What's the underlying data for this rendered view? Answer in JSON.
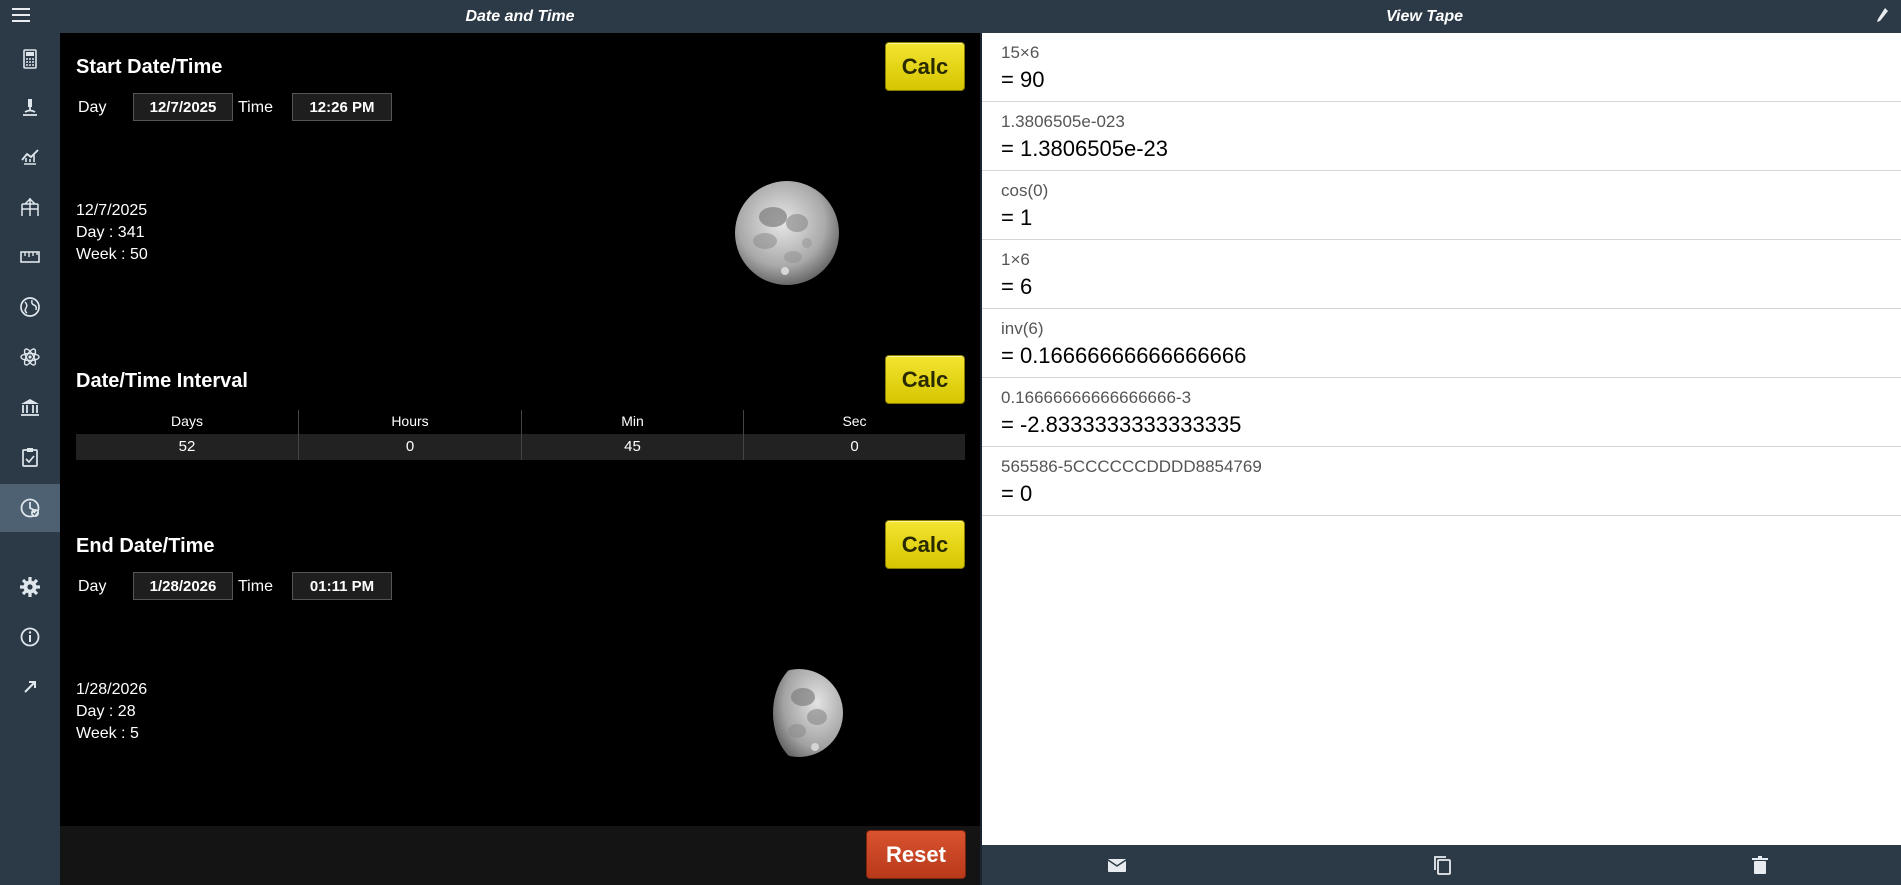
{
  "header": {
    "left_title": "Date and Time",
    "right_title": "View Tape"
  },
  "start": {
    "title": "Start Date/Time",
    "calc_label": "Calc",
    "day_label": "Day",
    "day_value": "12/7/2025",
    "time_label": "Time",
    "time_value": "12:26 PM",
    "date_line": "12/7/2025",
    "day_line": "Day : 341",
    "week_line": "Week : 50"
  },
  "interval": {
    "title": "Date/Time Interval",
    "calc_label": "Calc",
    "columns": [
      {
        "header": "Days",
        "value": "52"
      },
      {
        "header": "Hours",
        "value": "0"
      },
      {
        "header": "Min",
        "value": "45"
      },
      {
        "header": "Sec",
        "value": "0"
      }
    ]
  },
  "end": {
    "title": "End Date/Time",
    "calc_label": "Calc",
    "day_label": "Day",
    "day_value": "1/28/2026",
    "time_label": "Time",
    "time_value": "01:11 PM",
    "date_line": "1/28/2026",
    "day_line": "Day : 28",
    "week_line": "Week : 5"
  },
  "reset_label": "Reset",
  "tape": [
    {
      "expr": "15×6",
      "result": "= 90"
    },
    {
      "expr": "1.3806505e-023",
      "result": "= 1.3806505e-23"
    },
    {
      "expr": "cos(0)",
      "result": "= 1"
    },
    {
      "expr": "1×6",
      "result": "= 6"
    },
    {
      "expr": "inv(6)",
      "result": "= 0.16666666666666666"
    },
    {
      "expr": "0.16666666666666666-3",
      "result": "= -2.8333333333333335"
    },
    {
      "expr": "565586-5CCCCCCDDDD8854769",
      "result": "= 0"
    }
  ],
  "sidebar_icons": [
    "calculator-icon",
    "microscope-icon",
    "finance-icon",
    "structure-icon",
    "ruler-icon",
    "globe-icon",
    "atom-icon",
    "bank-icon",
    "clipboard-icon",
    "date-time-icon",
    "settings-icon",
    "info-icon",
    "external-link-icon"
  ],
  "colors": {
    "bar": "#2c3a47",
    "calc_button": "#e6d700",
    "reset_button": "#c9452a",
    "active_sidebar": "#4d6172"
  }
}
